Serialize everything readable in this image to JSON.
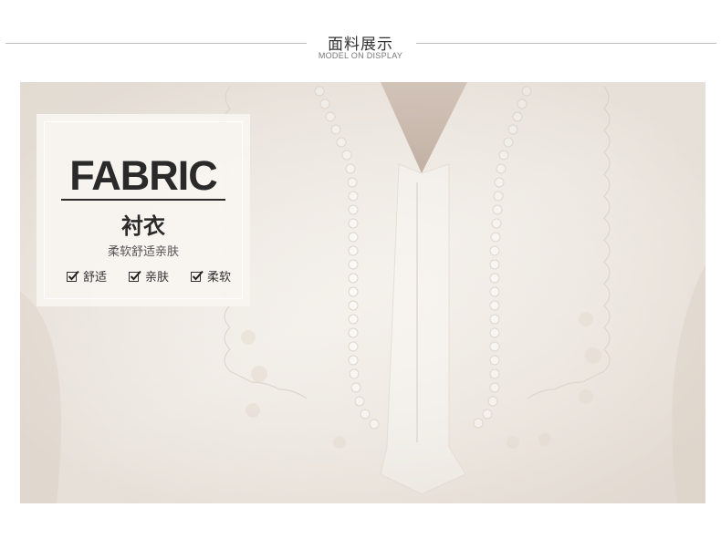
{
  "section": {
    "title": "面料展示",
    "subtitle": "MODEL ON DISPLAY"
  },
  "fabric": {
    "heading": "FABRIC",
    "name": "衬衣",
    "description": "柔软舒适亲肤",
    "features": [
      {
        "label": "舒适",
        "icon": "checkbox-checked-icon"
      },
      {
        "label": "亲肤",
        "icon": "checkbox-checked-icon"
      },
      {
        "label": "柔软",
        "icon": "checkbox-checked-icon"
      }
    ]
  },
  "colors": {
    "fabric": "#f3eee9",
    "lace": "#fbf9f6",
    "text_dark": "#2a2a2a"
  }
}
